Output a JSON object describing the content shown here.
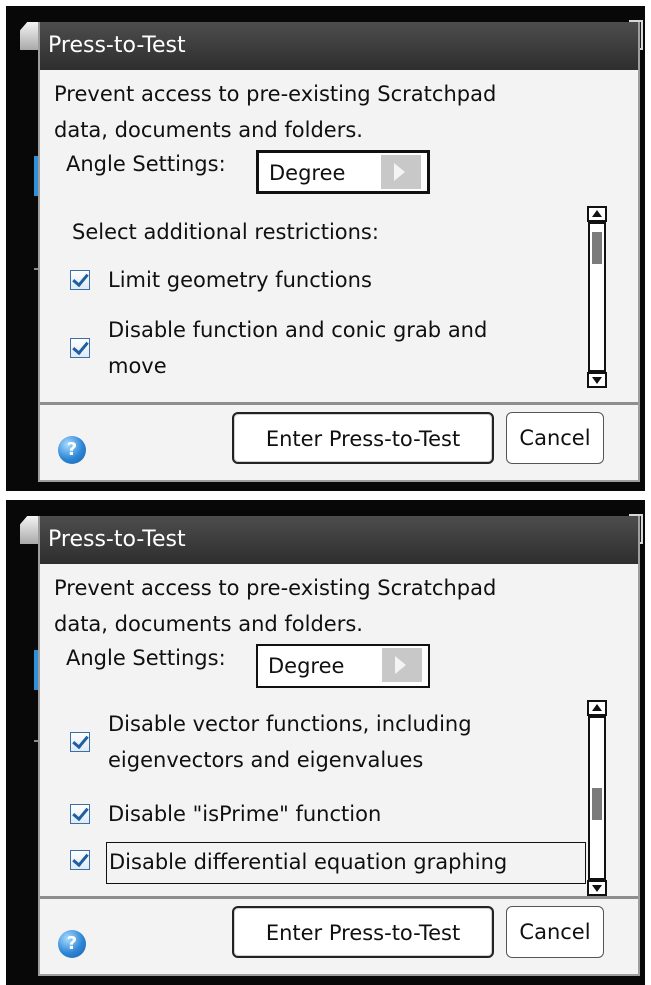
{
  "screens": [
    {
      "dialog": {
        "title": "Press-to-Test",
        "description_line1": "Prevent access to pre-existing Scratchpad",
        "description_line2": "data, documents and folders.",
        "angle_label": "Angle Settings:",
        "angle_value": "Degree",
        "restrictions_label": "Select additional restrictions:",
        "options": [
          {
            "line1": "Limit geometry functions",
            "line2": "",
            "checked": true
          },
          {
            "line1": "Disable function and conic grab and",
            "line2": "move",
            "checked": true
          }
        ],
        "scroll_position": 0.1,
        "help_icon": "question-mark",
        "enter_button": "Enter Press-to-Test",
        "cancel_button": "Cancel"
      }
    },
    {
      "dialog": {
        "title": "Press-to-Test",
        "description_line1": "Prevent access to pre-existing Scratchpad",
        "description_line2": "data, documents and folders.",
        "angle_label": "Angle Settings:",
        "angle_value": "Degree",
        "options": [
          {
            "line1": "Disable vector functions, including",
            "line2": "eigenvectors and eigenvalues",
            "checked": true
          },
          {
            "line1": "Disable \"isPrime\" function",
            "line2": "",
            "checked": true
          },
          {
            "line1": "Disable differential equation graphing",
            "line2": "",
            "checked": true
          }
        ],
        "scroll_position": 0.6,
        "help_icon": "question-mark",
        "enter_button": "Enter Press-to-Test",
        "cancel_button": "Cancel"
      }
    }
  ],
  "colors": {
    "titlebar": "#3a3a3a",
    "dialog_bg": "#f3f3f3",
    "accent_blue": "#2d86d6",
    "checkbox_check": "#1f5fa0",
    "battery_green": "#47c83a"
  }
}
